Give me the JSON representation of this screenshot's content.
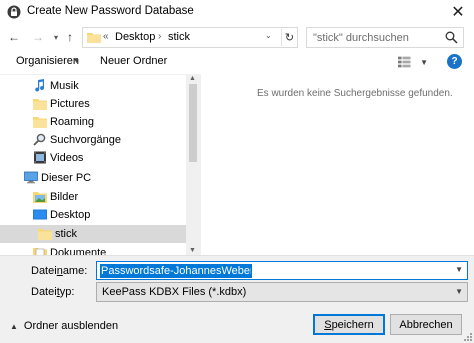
{
  "window": {
    "title": "Create New Password Database",
    "close_glyph": "✕"
  },
  "nav": {
    "back_glyph": "←",
    "forward_glyph": "→",
    "dropdown_glyph": "▾",
    "up_glyph": "↑"
  },
  "address": {
    "overflow": "«",
    "crumbs": [
      "Desktop",
      "stick"
    ],
    "separator": "›",
    "dropdown_glyph": "⌄",
    "refresh_glyph": "↻"
  },
  "search": {
    "placeholder": "\"stick\" durchsuchen"
  },
  "commandbar": {
    "organize_label": "Organisieren",
    "organize_arrow": "▼",
    "new_folder_label": "Neuer Ordner",
    "help_glyph": "?"
  },
  "tree": {
    "items": [
      {
        "label": "Musik",
        "icon": "music-icon"
      },
      {
        "label": "Pictures",
        "icon": "folder-icon"
      },
      {
        "label": "Roaming",
        "icon": "folder-icon"
      },
      {
        "label": "Suchvorgänge",
        "icon": "search-folder-icon"
      },
      {
        "label": "Videos",
        "icon": "videos-icon"
      },
      {
        "label": "Dieser PC",
        "icon": "computer-icon"
      },
      {
        "label": "Bilder",
        "icon": "pictures-icon"
      },
      {
        "label": "Desktop",
        "icon": "desktop-icon"
      },
      {
        "label": "stick",
        "icon": "folder-icon",
        "selected": true
      },
      {
        "label": "Dokumente",
        "icon": "documents-icon"
      }
    ]
  },
  "content": {
    "empty_message": "Es wurden keine Suchergebnisse gefunden."
  },
  "footer": {
    "filename_label_pre": "Datei",
    "filename_label_ul": "n",
    "filename_label_post": "ame:",
    "filename_value": "Passwordsafe-JohannesWeber.kdbx",
    "filetype_label_pre": "Datei",
    "filetype_label_ul": "t",
    "filetype_label_post": "yp:",
    "filetype_value": "KeePass KDBX Files (*.kdbx)",
    "hide_folders_label": "Ordner ausblenden",
    "hide_folders_glyph": "▲",
    "save_label_ul": "S",
    "save_label_rest": "peichern",
    "cancel_label": "Abbrechen"
  },
  "colors": {
    "accent": "#0078d7",
    "folder": "#f8d775",
    "selection": "#d9d9d9"
  }
}
